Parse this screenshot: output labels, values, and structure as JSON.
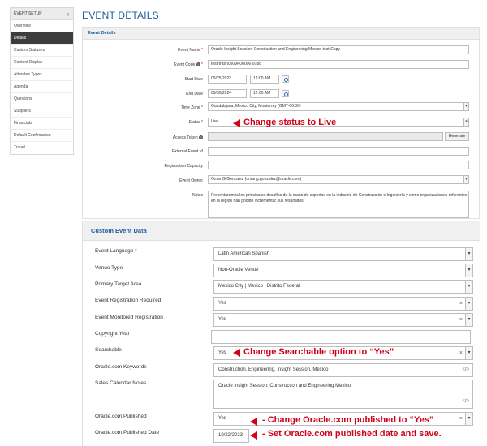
{
  "sidebar": {
    "header": "EVENT SETUP",
    "items": [
      {
        "label": "Overview"
      },
      {
        "label": "Details"
      },
      {
        "label": "Custom Statuses"
      },
      {
        "label": "Content Display"
      },
      {
        "label": "Attendee Types"
      },
      {
        "label": "Agenda"
      },
      {
        "label": "Questions"
      },
      {
        "label": "Suppliers"
      },
      {
        "label": "Financials"
      },
      {
        "label": "Default Confirmation"
      },
      {
        "label": "Travel"
      }
    ]
  },
  "page_title": "EVENT DETAILS",
  "event_details": {
    "panel_title": "Event Details",
    "event_name_label": "Event Name",
    "event_name": "Oracle Insight Session: Construction and Engineering Mexico-test-Copy",
    "event_code_label": "Event Code",
    "event_code": "test-trash0509P00006-9788",
    "start_date_label": "Start Date",
    "start_date": "09/25/2023",
    "start_time": "12:00 AM",
    "end_date_label": "End Date",
    "end_date": "09/30/2024",
    "end_time": "12:00 AM",
    "time_zone_label": "Time Zone",
    "time_zone": "Guadalajara, Mexico City, Monterrey (GMT-06:00)",
    "status_label": "Status",
    "status": "Live",
    "access_token_label": "Access Token",
    "generate_label": "Generate",
    "external_id_label": "External Event Id",
    "reg_capacity_label": "Registration Capacity",
    "event_owner_label": "Event Owner",
    "event_owner": "Omar G Gonzalez (omar.g.gonzalez@oracle.com)",
    "notes_label": "Notes",
    "notes_line1": "Presentaremos los principales desafíos de la mano de expertos en la industria de Construcción e Ingeniería y cómo organizaciones referentes",
    "notes_line2": "en la región han podido incrementar sus resultados."
  },
  "custom_data": {
    "panel_title": "Custom Event Data",
    "event_language_label": "Event Language",
    "event_language": "Latin American Spanish",
    "venue_type_label": "Venue Type",
    "venue_type": "Non-Oracle Venue",
    "primary_target_label": "Primary Target Area",
    "primary_target": "Mexico City | Mexico | Distrito Federal",
    "reg_required_label": "Event Registration Required",
    "reg_required": "Yes",
    "monitored_reg_label": "Event Monitored Registration",
    "monitored_reg": "Yes",
    "copyright_label": "Copyright Year",
    "searchable_label": "Searchable",
    "searchable": "Yes",
    "keywords_label": "Oracle.com Keywords",
    "keywords": "Construction, Engineering, Insight Session, Mexico",
    "sales_notes_label": "Sales Calendar Notes",
    "sales_notes": "Oracle Insight Session: Construction and Engineering Mexico",
    "published_label": "Oracle.com Published",
    "published": "Yes",
    "published_date_label": "Oracle.com Published Date",
    "published_date": "10/22/2023"
  },
  "annotations": {
    "status": "Change status to Live",
    "searchable": "Change Searchable option to “Yes”",
    "published": "- Change Oracle.com published to “Yes”",
    "published_date": "- Set Oracle.com published date and save."
  },
  "colors": {
    "accent": "#1f5c99",
    "annotation_red": "#d0021b",
    "sidebar_active": "#3d3d3d"
  }
}
